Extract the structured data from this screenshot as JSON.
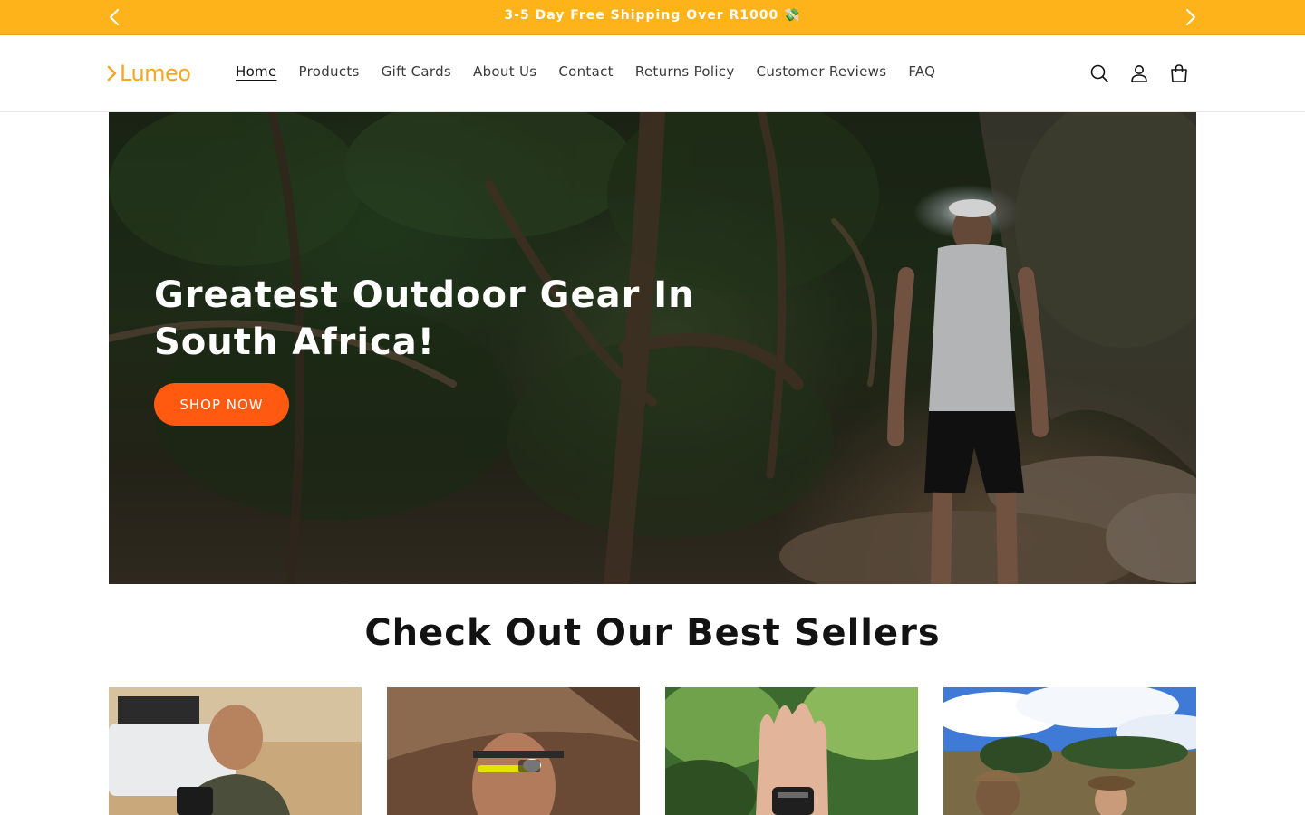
{
  "announcement": {
    "text": "3-5 Day Free Shipping Over R1000 💸"
  },
  "brand": {
    "name": "Lumeo",
    "accent": "#F5A623"
  },
  "nav": {
    "items": [
      {
        "label": "Home",
        "active": true
      },
      {
        "label": "Products"
      },
      {
        "label": "Gift Cards"
      },
      {
        "label": "About Us"
      },
      {
        "label": "Contact"
      },
      {
        "label": "Returns Policy"
      },
      {
        "label": "Customer Reviews"
      },
      {
        "label": "FAQ"
      }
    ]
  },
  "header_icons": [
    "search-icon",
    "account-icon",
    "cart-icon"
  ],
  "hero": {
    "title": "Greatest Outdoor Gear In South Africa!",
    "button": "SHOP NOW",
    "button_color": "#FF5A0F"
  },
  "best_sellers": {
    "title": "Check Out Our Best Sellers",
    "products": [
      {
        "image": "man-with-tire-inflator-by-truck"
      },
      {
        "image": "man-wearing-headlamp"
      },
      {
        "image": "hand-holding-multitool-card"
      },
      {
        "image": "hikers-in-field-under-blue-sky"
      }
    ]
  },
  "colors": {
    "announcement_bg": "#FFB31A",
    "text": "#121212"
  }
}
